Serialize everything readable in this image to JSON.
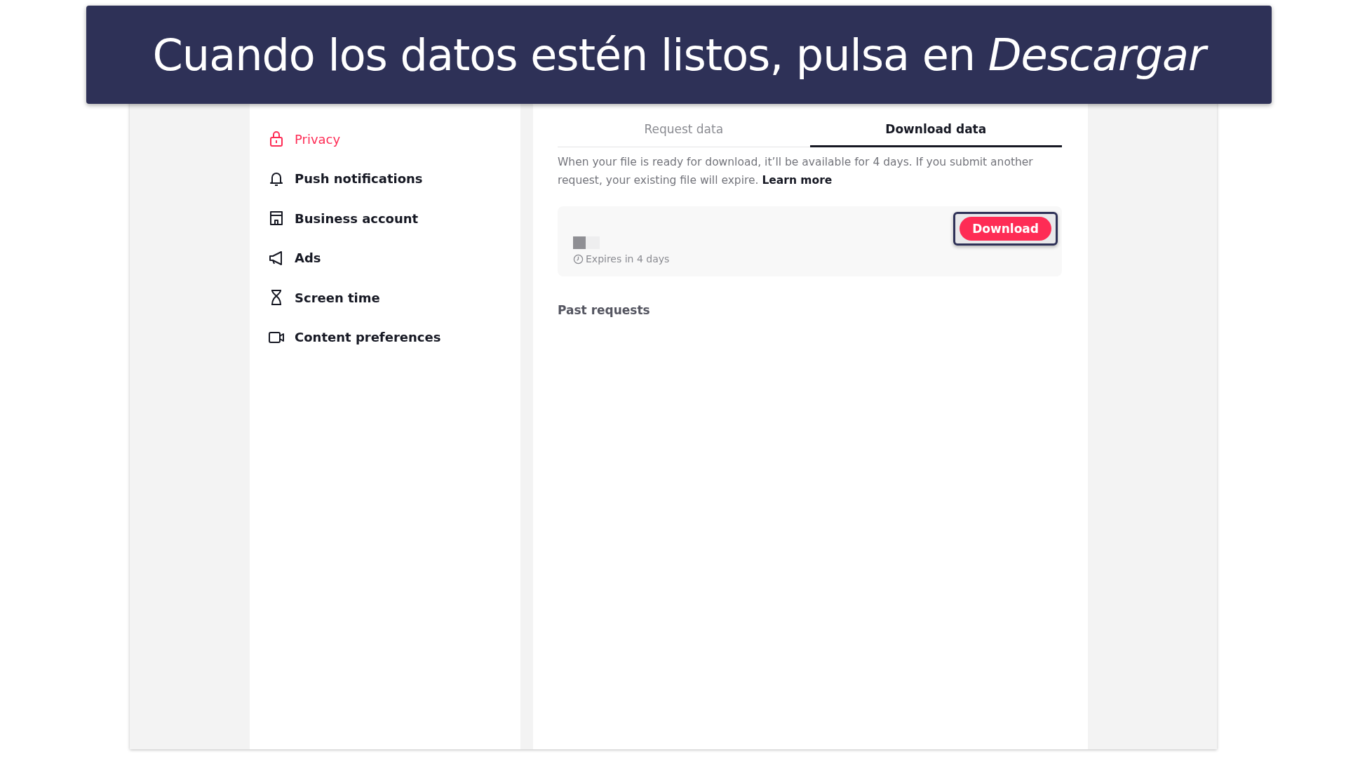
{
  "caption": "Cuando los datos estén listos, pulsa en *Descargar*",
  "sidebar": {
    "items": [
      {
        "label": "Privacy",
        "selected": true
      },
      {
        "label": "Push notifications",
        "selected": false
      },
      {
        "label": "Business account",
        "selected": false
      },
      {
        "label": "Ads",
        "selected": false
      },
      {
        "label": "Screen time",
        "selected": false
      },
      {
        "label": "Content preferences",
        "selected": false
      }
    ]
  },
  "tabs": [
    {
      "label": "Request data",
      "selected": false
    },
    {
      "label": "Download data",
      "selected": true
    }
  ],
  "info": {
    "text": "When your file is ready for download, it’ll be available for 4 days. If you submit another request, your existing file will expire.",
    "link": "Learn more"
  },
  "file": {
    "expires": "Expires in 4 days",
    "button": "Download",
    "highlighted": true
  },
  "past_requests": "Past requests"
}
